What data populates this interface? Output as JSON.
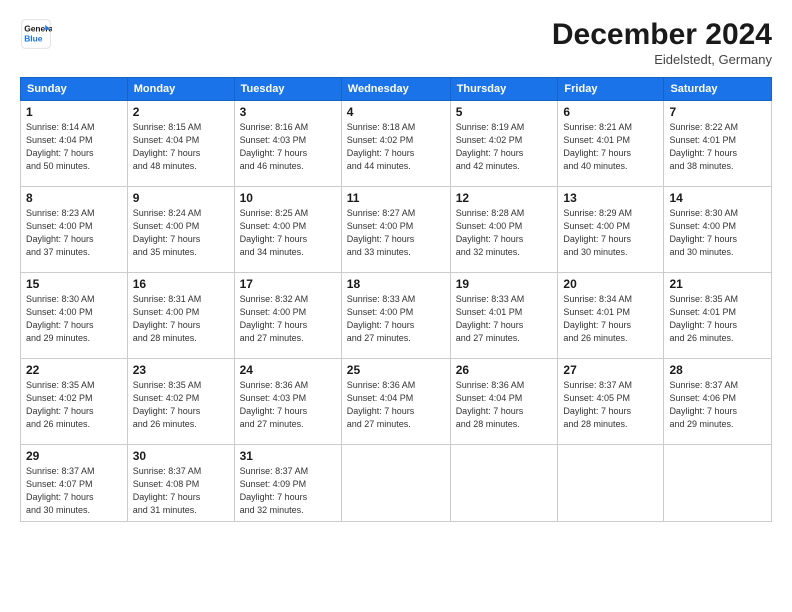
{
  "logo": {
    "line1": "General",
    "line2": "Blue"
  },
  "title": "December 2024",
  "location": "Eidelstedt, Germany",
  "weekdays": [
    "Sunday",
    "Monday",
    "Tuesday",
    "Wednesday",
    "Thursday",
    "Friday",
    "Saturday"
  ],
  "weeks": [
    [
      {
        "day": "1",
        "info": "Sunrise: 8:14 AM\nSunset: 4:04 PM\nDaylight: 7 hours\nand 50 minutes."
      },
      {
        "day": "2",
        "info": "Sunrise: 8:15 AM\nSunset: 4:04 PM\nDaylight: 7 hours\nand 48 minutes."
      },
      {
        "day": "3",
        "info": "Sunrise: 8:16 AM\nSunset: 4:03 PM\nDaylight: 7 hours\nand 46 minutes."
      },
      {
        "day": "4",
        "info": "Sunrise: 8:18 AM\nSunset: 4:02 PM\nDaylight: 7 hours\nand 44 minutes."
      },
      {
        "day": "5",
        "info": "Sunrise: 8:19 AM\nSunset: 4:02 PM\nDaylight: 7 hours\nand 42 minutes."
      },
      {
        "day": "6",
        "info": "Sunrise: 8:21 AM\nSunset: 4:01 PM\nDaylight: 7 hours\nand 40 minutes."
      },
      {
        "day": "7",
        "info": "Sunrise: 8:22 AM\nSunset: 4:01 PM\nDaylight: 7 hours\nand 38 minutes."
      }
    ],
    [
      {
        "day": "8",
        "info": "Sunrise: 8:23 AM\nSunset: 4:00 PM\nDaylight: 7 hours\nand 37 minutes."
      },
      {
        "day": "9",
        "info": "Sunrise: 8:24 AM\nSunset: 4:00 PM\nDaylight: 7 hours\nand 35 minutes."
      },
      {
        "day": "10",
        "info": "Sunrise: 8:25 AM\nSunset: 4:00 PM\nDaylight: 7 hours\nand 34 minutes."
      },
      {
        "day": "11",
        "info": "Sunrise: 8:27 AM\nSunset: 4:00 PM\nDaylight: 7 hours\nand 33 minutes."
      },
      {
        "day": "12",
        "info": "Sunrise: 8:28 AM\nSunset: 4:00 PM\nDaylight: 7 hours\nand 32 minutes."
      },
      {
        "day": "13",
        "info": "Sunrise: 8:29 AM\nSunset: 4:00 PM\nDaylight: 7 hours\nand 30 minutes."
      },
      {
        "day": "14",
        "info": "Sunrise: 8:30 AM\nSunset: 4:00 PM\nDaylight: 7 hours\nand 30 minutes."
      }
    ],
    [
      {
        "day": "15",
        "info": "Sunrise: 8:30 AM\nSunset: 4:00 PM\nDaylight: 7 hours\nand 29 minutes."
      },
      {
        "day": "16",
        "info": "Sunrise: 8:31 AM\nSunset: 4:00 PM\nDaylight: 7 hours\nand 28 minutes."
      },
      {
        "day": "17",
        "info": "Sunrise: 8:32 AM\nSunset: 4:00 PM\nDaylight: 7 hours\nand 27 minutes."
      },
      {
        "day": "18",
        "info": "Sunrise: 8:33 AM\nSunset: 4:00 PM\nDaylight: 7 hours\nand 27 minutes."
      },
      {
        "day": "19",
        "info": "Sunrise: 8:33 AM\nSunset: 4:01 PM\nDaylight: 7 hours\nand 27 minutes."
      },
      {
        "day": "20",
        "info": "Sunrise: 8:34 AM\nSunset: 4:01 PM\nDaylight: 7 hours\nand 26 minutes."
      },
      {
        "day": "21",
        "info": "Sunrise: 8:35 AM\nSunset: 4:01 PM\nDaylight: 7 hours\nand 26 minutes."
      }
    ],
    [
      {
        "day": "22",
        "info": "Sunrise: 8:35 AM\nSunset: 4:02 PM\nDaylight: 7 hours\nand 26 minutes."
      },
      {
        "day": "23",
        "info": "Sunrise: 8:35 AM\nSunset: 4:02 PM\nDaylight: 7 hours\nand 26 minutes."
      },
      {
        "day": "24",
        "info": "Sunrise: 8:36 AM\nSunset: 4:03 PM\nDaylight: 7 hours\nand 27 minutes."
      },
      {
        "day": "25",
        "info": "Sunrise: 8:36 AM\nSunset: 4:04 PM\nDaylight: 7 hours\nand 27 minutes."
      },
      {
        "day": "26",
        "info": "Sunrise: 8:36 AM\nSunset: 4:04 PM\nDaylight: 7 hours\nand 28 minutes."
      },
      {
        "day": "27",
        "info": "Sunrise: 8:37 AM\nSunset: 4:05 PM\nDaylight: 7 hours\nand 28 minutes."
      },
      {
        "day": "28",
        "info": "Sunrise: 8:37 AM\nSunset: 4:06 PM\nDaylight: 7 hours\nand 29 minutes."
      }
    ],
    [
      {
        "day": "29",
        "info": "Sunrise: 8:37 AM\nSunset: 4:07 PM\nDaylight: 7 hours\nand 30 minutes."
      },
      {
        "day": "30",
        "info": "Sunrise: 8:37 AM\nSunset: 4:08 PM\nDaylight: 7 hours\nand 31 minutes."
      },
      {
        "day": "31",
        "info": "Sunrise: 8:37 AM\nSunset: 4:09 PM\nDaylight: 7 hours\nand 32 minutes."
      },
      {
        "day": "",
        "info": ""
      },
      {
        "day": "",
        "info": ""
      },
      {
        "day": "",
        "info": ""
      },
      {
        "day": "",
        "info": ""
      }
    ]
  ]
}
